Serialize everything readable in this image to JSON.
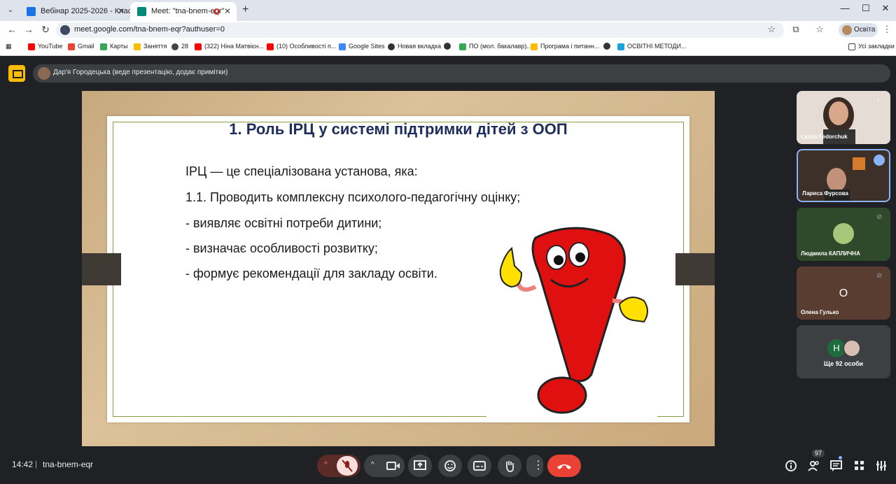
{
  "browser": {
    "tabs": [
      {
        "label": "Вебінар 2025-2026 - Клас",
        "active": false
      },
      {
        "label": "Meet: \"tna-bnem-eqr\"",
        "active": true
      }
    ],
    "url": "meet.google.com/tna-bnem-eqr?authuser=0",
    "profile_label": "Освіта",
    "bookmarks": [
      "YouTube",
      "Gmail",
      "Карты",
      "Заняття",
      "28",
      "(322) Ніна Матвієн...",
      "(10) Особливості п...",
      "Google Sites",
      "Новая вкладка",
      "ПО (мол. бакалавр)...",
      "Програма і питанн...",
      "ОСВІТНІ МЕТОДИ..."
    ],
    "all_bookmarks": "Усі закладки"
  },
  "meet": {
    "presenter_text": "Дар'я Городецька (веде презентацію, додає примітки)",
    "slide": {
      "title": "1. Роль ІРЦ у системі підтримки дітей з ООП",
      "lines": [
        "ІРЦ — це спеціалізована установа, яка:",
        "1.1. Проводить комплексну психолого-педагогічну оцінку;",
        " - виявляє освітні потреби дитини;",
        " - визначає особливості розвитку;",
        "-  формує рекомендації для закладу освіти."
      ]
    },
    "participants": [
      {
        "name": "Larisa Fedorchuk"
      },
      {
        "name": "Лариса Фурсова"
      },
      {
        "name": "Людмила КАПЛИЧНА"
      },
      {
        "name": "Олена Гулько",
        "initial": "О"
      },
      {
        "name": "Ще 92 особи",
        "initial": "Н"
      }
    ],
    "time": "14:42",
    "meeting_code": "tna-bnem-eqr",
    "people_count": "97",
    "colors": {
      "accent": "#fbbc04",
      "end_call": "#ea4335",
      "title": "#1f2d5c"
    }
  }
}
